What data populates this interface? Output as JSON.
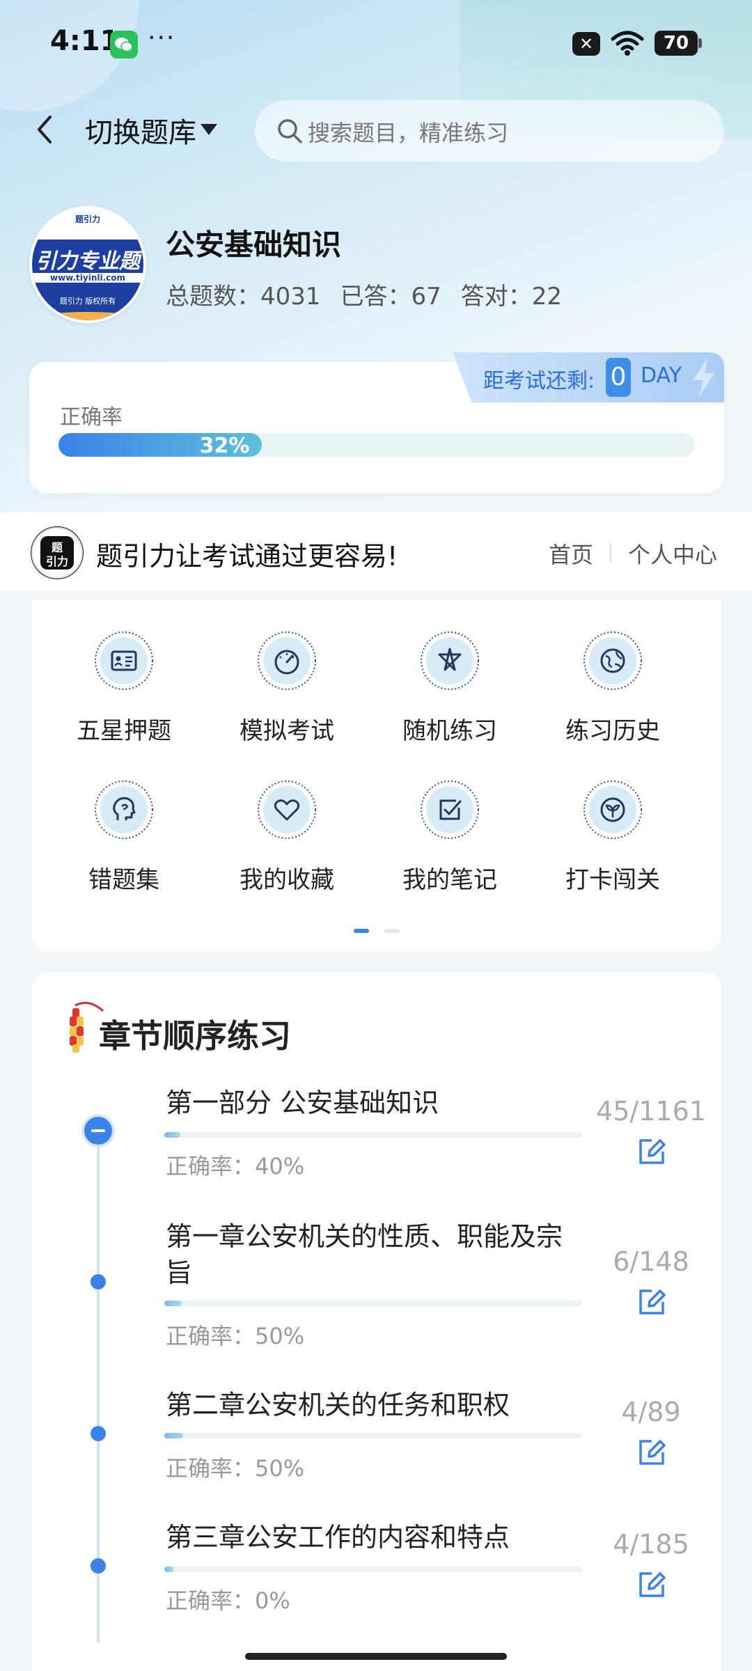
{
  "status_bar": {
    "time": "4:11",
    "dots": "···",
    "battery": "70"
  },
  "header": {
    "switch_label": "切换题库",
    "search_placeholder": "搜索题目，精准练习"
  },
  "subject": {
    "logo_top": "题引力",
    "logo_text": "引力专业题",
    "logo_url": "www.tiyinli.com",
    "logo_foot": "题引力 版权所有",
    "title": "公安基础知识",
    "total_label": "总题数：4031",
    "answered_label": "已答：67",
    "correct_label": "答对：22"
  },
  "accuracy": {
    "label": "正确率",
    "percent_text": "32%",
    "percent": 32,
    "countdown_label": "距考试还剩:",
    "countdown_value": "0",
    "countdown_unit": "DAY"
  },
  "promo": {
    "slogan": "题引力让考试通过更容易!",
    "home": "首页",
    "profile": "个人中心"
  },
  "grid": {
    "items": [
      {
        "label": "五星押题",
        "icon": "id-card-icon"
      },
      {
        "label": "模拟考试",
        "icon": "speedometer-icon"
      },
      {
        "label": "随机练习",
        "icon": "random-icon"
      },
      {
        "label": "练习历史",
        "icon": "globe-icon"
      },
      {
        "label": "错题集",
        "icon": "head-icon"
      },
      {
        "label": "我的收藏",
        "icon": "heart-icon"
      },
      {
        "label": "我的笔记",
        "icon": "note-check-icon"
      },
      {
        "label": "打卡闯关",
        "icon": "sprout-icon"
      }
    ],
    "page": 1,
    "pages": 2
  },
  "chapters": {
    "title": "章节顺序练习",
    "rows": [
      {
        "title": "第一部分 公安基础知识",
        "accuracy": "正确率：40%",
        "count": "45/1161",
        "progress": 0.039
      },
      {
        "title": "第一章公安机关的性质、职能及宗旨",
        "accuracy": "正确率：50%",
        "count": "6/148",
        "progress": 0.041
      },
      {
        "title": "第二章公安机关的任务和职权",
        "accuracy": "正确率：50%",
        "count": "4/89",
        "progress": 0.045
      },
      {
        "title": "第三章公安工作的内容和特点",
        "accuracy": "正确率：0%",
        "count": "4/185",
        "progress": 0.022
      }
    ]
  },
  "colors": {
    "accent": "#3b82e8",
    "promo_green": "#2bc25b",
    "countdown_text": "#2a6fd8"
  }
}
